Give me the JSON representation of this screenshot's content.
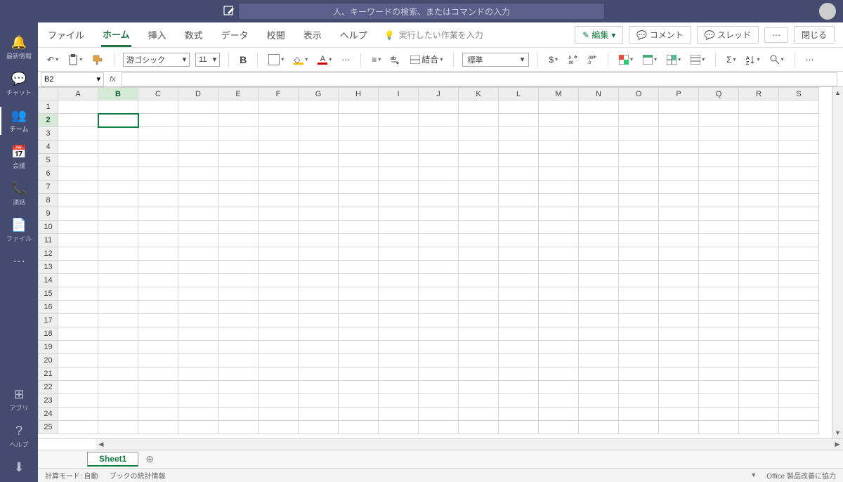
{
  "search": {
    "placeholder": "人、キーワードの検索、またはコマンドの入力"
  },
  "rail": {
    "items": [
      {
        "icon": "🔔",
        "label": "最新情報"
      },
      {
        "icon": "💬",
        "label": "チャット"
      },
      {
        "icon": "👥",
        "label": "チーム"
      },
      {
        "icon": "📅",
        "label": "会議"
      },
      {
        "icon": "📞",
        "label": "通話"
      },
      {
        "icon": "📄",
        "label": "ファイル"
      },
      {
        "icon": "⋯",
        "label": ""
      }
    ],
    "bottom": [
      {
        "icon": "⊞",
        "label": "アプリ"
      },
      {
        "icon": "?",
        "label": "ヘルプ"
      }
    ],
    "download": "⬇"
  },
  "tabs": {
    "items": [
      "ファイル",
      "ホーム",
      "挿入",
      "数式",
      "データ",
      "校閲",
      "表示",
      "ヘルプ"
    ],
    "active": 1,
    "tellme": "実行したい作業を入力"
  },
  "topbuttons": {
    "edit": "編集",
    "comment": "コメント",
    "thread": "スレッド",
    "close": "閉じる"
  },
  "ribbon": {
    "font": "游ゴシック",
    "size": "11",
    "merge": "結合",
    "numfmt": "標準"
  },
  "namebox": "B2",
  "cols": [
    "A",
    "B",
    "C",
    "D",
    "E",
    "F",
    "G",
    "H",
    "I",
    "J",
    "K",
    "L",
    "M",
    "N",
    "O",
    "P",
    "Q",
    "R",
    "S"
  ],
  "rows": 25,
  "selected": {
    "col": 1,
    "row": 1
  },
  "sheets": [
    "Sheet1"
  ],
  "status": {
    "mode": "計算モード: 自動",
    "stats": "ブックの統計情報",
    "improve": "Office 製品改善に協力"
  }
}
